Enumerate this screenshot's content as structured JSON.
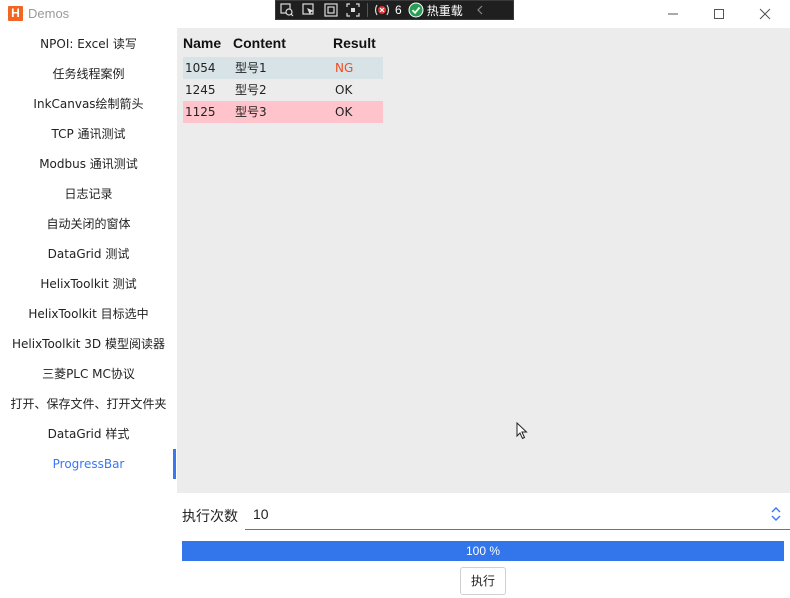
{
  "window": {
    "title": "Demos",
    "logo_letter": "H"
  },
  "devbar": {
    "exception_count": "6",
    "hot_reload_label": "热重载"
  },
  "sidebar": {
    "items": [
      {
        "label": "NPOI: Excel 读写"
      },
      {
        "label": "任务线程案例"
      },
      {
        "label": "InkCanvas绘制箭头"
      },
      {
        "label": "TCP 通讯测试"
      },
      {
        "label": "Modbus 通讯测试"
      },
      {
        "label": "日志记录"
      },
      {
        "label": "自动关闭的窗体"
      },
      {
        "label": "DataGrid 测试"
      },
      {
        "label": "HelixToolkit 测试"
      },
      {
        "label": "HelixToolkit 目标选中"
      },
      {
        "label": "HelixToolkit 3D 模型阅读器"
      },
      {
        "label": "三菱PLC MC协议"
      },
      {
        "label": "打开、保存文件、打开文件夹"
      },
      {
        "label": "DataGrid 样式"
      },
      {
        "label": "ProgressBar"
      }
    ],
    "selected_index": 14
  },
  "grid": {
    "columns": [
      "Name",
      "Content",
      "Result"
    ],
    "rows": [
      {
        "name": "1054",
        "content": "型号1",
        "result": "NG"
      },
      {
        "name": "1245",
        "content": "型号2",
        "result": "OK"
      },
      {
        "name": "1125",
        "content": "型号3",
        "result": "OK"
      }
    ]
  },
  "execution": {
    "count_label": "执行次数",
    "count_value": "10",
    "progress_percent": 100,
    "progress_text": "100 %",
    "run_button": "执行"
  },
  "colors": {
    "accent": "#3a78f2",
    "progress_fill": "#3375ea",
    "ng_text": "#f24c1f",
    "row_ng_bg": "#d8e3e7",
    "row_bad_bg": "#ffc3cb",
    "main_bg": "#ececec"
  }
}
